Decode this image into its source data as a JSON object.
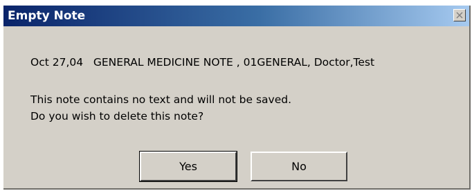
{
  "window": {
    "title": "Empty Note"
  },
  "titlebar": {
    "close_icon": "close-icon"
  },
  "content": {
    "note_info": "Oct 27,04   GENERAL MEDICINE NOTE , 01GENERAL, Doctor,Test",
    "message_line1": "This note contains no text and will not be saved.",
    "message_line2": "Do you wish to delete this note?"
  },
  "buttons": {
    "yes_label": "Yes",
    "no_label": "No"
  },
  "colors": {
    "dialog_bg": "#d4d0c8",
    "title_gradient_start": "#0a246a",
    "title_gradient_end": "#a6caf0",
    "title_text": "#ffffff"
  }
}
